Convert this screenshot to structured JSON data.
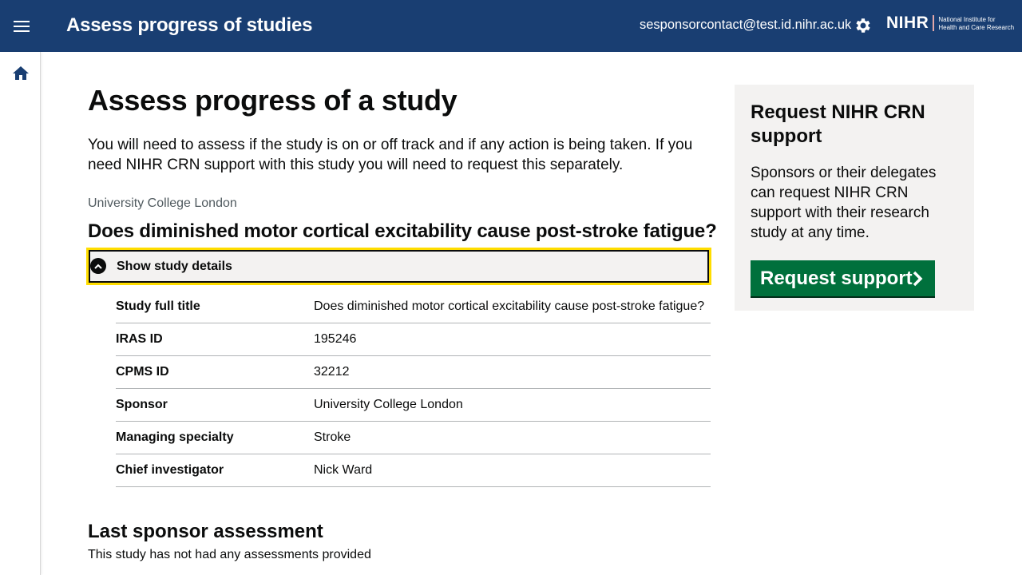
{
  "header": {
    "app_title": "Assess progress of studies",
    "user_email": "sesponsorcontact@test.id.nihr.ac.uk",
    "logo_main": "NIHR",
    "logo_sub_line1": "National Institute for",
    "logo_sub_line2": "Health and Care Research",
    "menu_icon": "hamburger-menu-icon",
    "settings_icon": "gear-icon",
    "background_color": "#193e72"
  },
  "sidebar": {
    "home_icon": "home-icon"
  },
  "main": {
    "page_title": "Assess progress of a study",
    "intro": "You will need to assess if the study is on or off track and if any action is being taken. If you need NIHR CRN support with this study you will need to request this separately.",
    "organisation": "University College London",
    "study_title": "Does diminished motor cortical excitability cause post-stroke fatigue?",
    "details_toggle_label": "Show study details",
    "details": [
      {
        "key": "Study full title",
        "value": "Does diminished motor cortical excitability cause post-stroke fatigue?"
      },
      {
        "key": "IRAS ID",
        "value": "195246"
      },
      {
        "key": "CPMS ID",
        "value": "32212"
      },
      {
        "key": "Sponsor",
        "value": "University College London"
      },
      {
        "key": "Managing specialty",
        "value": "Stroke"
      },
      {
        "key": "Chief investigator",
        "value": "Nick Ward"
      }
    ],
    "last_assessment_title": "Last sponsor assessment",
    "last_assessment_text": "This study has not had any assessments provided"
  },
  "aside": {
    "title": "Request NIHR CRN support",
    "text": "Sponsors or their delegates can request NIHR CRN support with their research study at any time.",
    "button_label": "Request support",
    "button_color": "#00703c"
  }
}
